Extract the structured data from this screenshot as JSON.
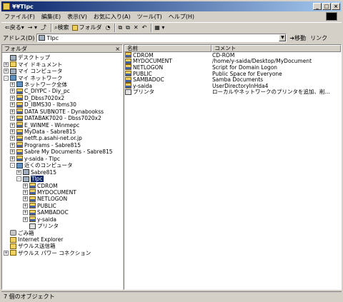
{
  "window": {
    "title": "¥¥Tlpc"
  },
  "menu": [
    "ファイル(F)",
    "編集(E)",
    "表示(V)",
    "お気に入り(A)",
    "ツール(T)",
    "ヘルプ(H)"
  ],
  "toolbar": {
    "back": "戻る",
    "search": "検索",
    "folders": "フォルダ"
  },
  "address": {
    "label": "アドレス(D)",
    "value": "Tlpc",
    "go": "移動",
    "links": "リンク"
  },
  "left_pane": {
    "title": "フォルダ",
    "close": "×"
  },
  "tree": [
    {
      "label": "デスクトップ",
      "level": 0,
      "exp": "",
      "icon": "pc"
    },
    {
      "label": "マイ ドキュメント",
      "level": 0,
      "exp": "+",
      "icon": "folder"
    },
    {
      "label": "マイ コンピュータ",
      "level": 0,
      "exp": "+",
      "icon": "pc"
    },
    {
      "label": "マイ ネットワーク",
      "level": 0,
      "exp": "-",
      "icon": "net"
    },
    {
      "label": "ネットワーク全体",
      "level": 1,
      "exp": "+",
      "icon": "net"
    },
    {
      "label": "C_DIYPC - Diy_pc",
      "level": 1,
      "exp": "+",
      "icon": "share"
    },
    {
      "label": "D_Dbss7020x2",
      "level": 1,
      "exp": "+",
      "icon": "share"
    },
    {
      "label": "D_IBMS30 - Ibms30",
      "level": 1,
      "exp": "+",
      "icon": "share"
    },
    {
      "label": "DATA SUBNOTE - Dynabookss",
      "level": 1,
      "exp": "+",
      "icon": "share"
    },
    {
      "label": "DATABAK7020 - Dbss7020x2",
      "level": 1,
      "exp": "+",
      "icon": "share"
    },
    {
      "label": "E_WINME - Winmepc",
      "level": 1,
      "exp": "+",
      "icon": "share"
    },
    {
      "label": "MyData - Sabre815",
      "level": 1,
      "exp": "+",
      "icon": "share"
    },
    {
      "label": "netft.p.asahi-net.or.jp",
      "level": 1,
      "exp": "+",
      "icon": "share"
    },
    {
      "label": "Programs - Sabre815",
      "level": 1,
      "exp": "+",
      "icon": "share"
    },
    {
      "label": "Sabre My Documents - Sabre815",
      "level": 1,
      "exp": "+",
      "icon": "share"
    },
    {
      "label": "y-saida - Tlpc",
      "level": 1,
      "exp": "+",
      "icon": "share"
    },
    {
      "label": "近くのコンピュータ",
      "level": 1,
      "exp": "-",
      "icon": "net"
    },
    {
      "label": "Sabre815",
      "level": 2,
      "exp": "+",
      "icon": "pc"
    },
    {
      "label": "Tlpc",
      "level": 2,
      "exp": "-",
      "icon": "pc",
      "selected": true
    },
    {
      "label": "CDROM",
      "level": 3,
      "exp": "+",
      "icon": "share"
    },
    {
      "label": "MYDOCUMENT",
      "level": 3,
      "exp": "+",
      "icon": "share"
    },
    {
      "label": "NETLOGON",
      "level": 3,
      "exp": "+",
      "icon": "share"
    },
    {
      "label": "PUBLIC",
      "level": 3,
      "exp": "+",
      "icon": "share"
    },
    {
      "label": "SAMBADOC",
      "level": 3,
      "exp": "+",
      "icon": "share"
    },
    {
      "label": "y-saida",
      "level": 3,
      "exp": "+",
      "icon": "share"
    },
    {
      "label": "プリンタ",
      "level": 3,
      "exp": "",
      "icon": "print"
    },
    {
      "label": "ごみ箱",
      "level": 0,
      "exp": "",
      "icon": "trash"
    },
    {
      "label": "Internet Explorer",
      "level": 0,
      "exp": "",
      "icon": "folder"
    },
    {
      "label": "ザウルス送信箱",
      "level": 0,
      "exp": "",
      "icon": "folder"
    },
    {
      "label": "ザウルス パワー コネクション",
      "level": 0,
      "exp": "+",
      "icon": "folder"
    }
  ],
  "list": {
    "columns": [
      "名前",
      "コメント"
    ],
    "rows": [
      {
        "name": "CDROM",
        "comment": "CD-ROM",
        "icon": "share"
      },
      {
        "name": "MYDOCUMENT",
        "comment": "/home/y-saida/Desktop/MyDocument",
        "icon": "share"
      },
      {
        "name": "NETLOGON",
        "comment": "Script for Domain Logon",
        "icon": "share"
      },
      {
        "name": "PUBLIC",
        "comment": "Public Space for Everyone",
        "icon": "share"
      },
      {
        "name": "SAMBADOC",
        "comment": "Samba Documents",
        "icon": "share"
      },
      {
        "name": "y-saida",
        "comment": "UserDirectoryInHda4",
        "icon": "share"
      },
      {
        "name": "プリンタ",
        "comment": "ローカルやネットワークのプリンタを追加、削...",
        "icon": "print"
      }
    ]
  },
  "status": {
    "text": "7 個のオブジェクト"
  },
  "colors": {
    "titlebar_start": "#0a246a",
    "titlebar_end": "#a6caf0",
    "face": "#d4d0c8",
    "selection": "#0a246a"
  }
}
